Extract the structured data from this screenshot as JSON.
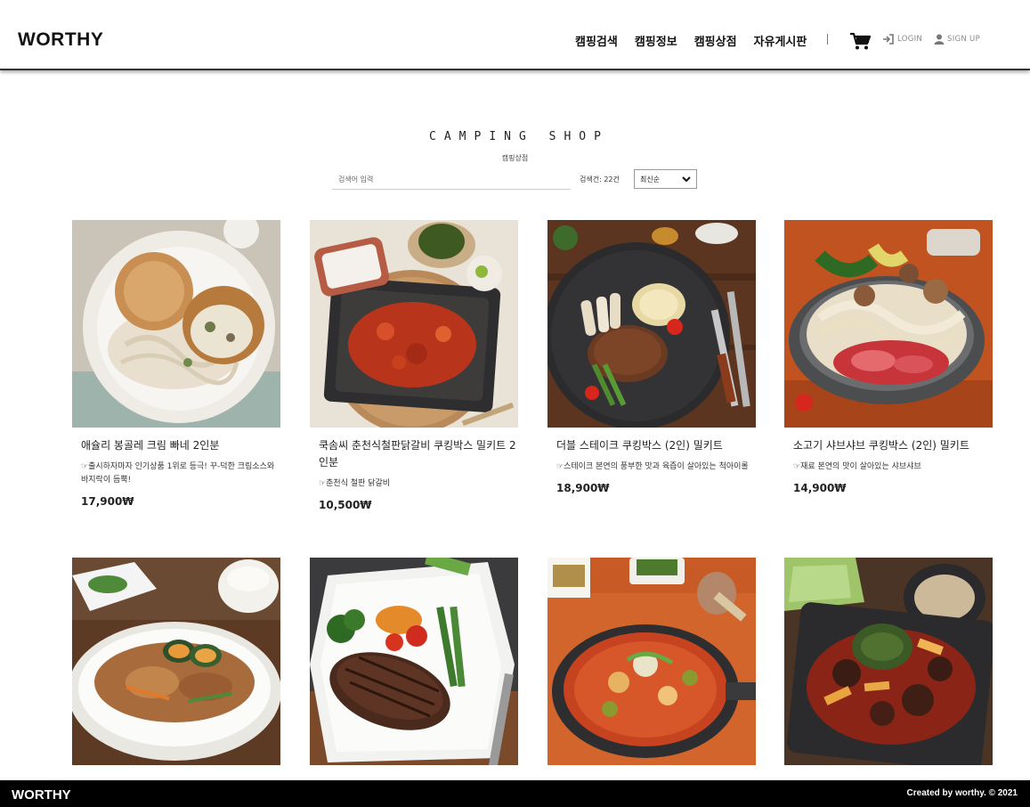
{
  "header": {
    "logo": "WORTHY",
    "nav": [
      "캠핑검색",
      "캠핑정보",
      "캠핑상점",
      "자유게시판"
    ],
    "login": "LOGIN",
    "signup": "SIGN UP"
  },
  "shop": {
    "title": "CAMPING SHOP",
    "subtitle": "캠핑상점",
    "search_placeholder": "검색어 입력",
    "count": "검색건: 22건",
    "sort_selected": "최신순"
  },
  "products": [
    {
      "name": "애슐리 봉골레 크림 빠네 2인분",
      "desc": "출시하자마자 인기상품 1위로 등극! 꾸-덕한 크림소스와 바지락이 듬뿍!",
      "price": "17,900₩",
      "image": "bread bowl cream pasta"
    },
    {
      "name": "쿡솜씨 춘천식철판닭갈비 쿠킹박스 밀키트 2인분",
      "desc": "춘천식 철판 닭갈비",
      "price": "10,500₩",
      "image": "spicy chicken on iron pan"
    },
    {
      "name": "더블 스테이크 쿠킹박스 (2인) 밀키트",
      "desc": "스테이크 본연의 풍부한 맛과 육즙이 살아있는 척아이롤",
      "price": "18,900₩",
      "image": "steak on black plate"
    },
    {
      "name": "소고기 샤브샤브 쿠킹박스 (2인) 밀키트",
      "desc": "재료 본연의 맛이 살아있는 샤브샤브",
      "price": "14,900₩",
      "image": "shabu shabu hot pot"
    },
    {
      "name": "",
      "desc": "",
      "price": "",
      "image": "stir fried pork with pumpkin"
    },
    {
      "name": "",
      "desc": "",
      "price": "",
      "image": "grilled steak with vegetables"
    },
    {
      "name": "",
      "desc": "",
      "price": "",
      "image": "spicy stew in pan"
    },
    {
      "name": "",
      "desc": "",
      "price": "",
      "image": "spicy braised sundae"
    }
  ],
  "footer": {
    "logo": "WORTHY",
    "copyright": "Created by worthy. © 2021"
  },
  "colors": {
    "header_border": "#333333",
    "footer_bg": "#000000",
    "text": "#222222"
  },
  "icons": [
    "cart-icon",
    "login-icon",
    "user-icon",
    "chevron-down-icon",
    "pointing-hand-icon"
  ]
}
